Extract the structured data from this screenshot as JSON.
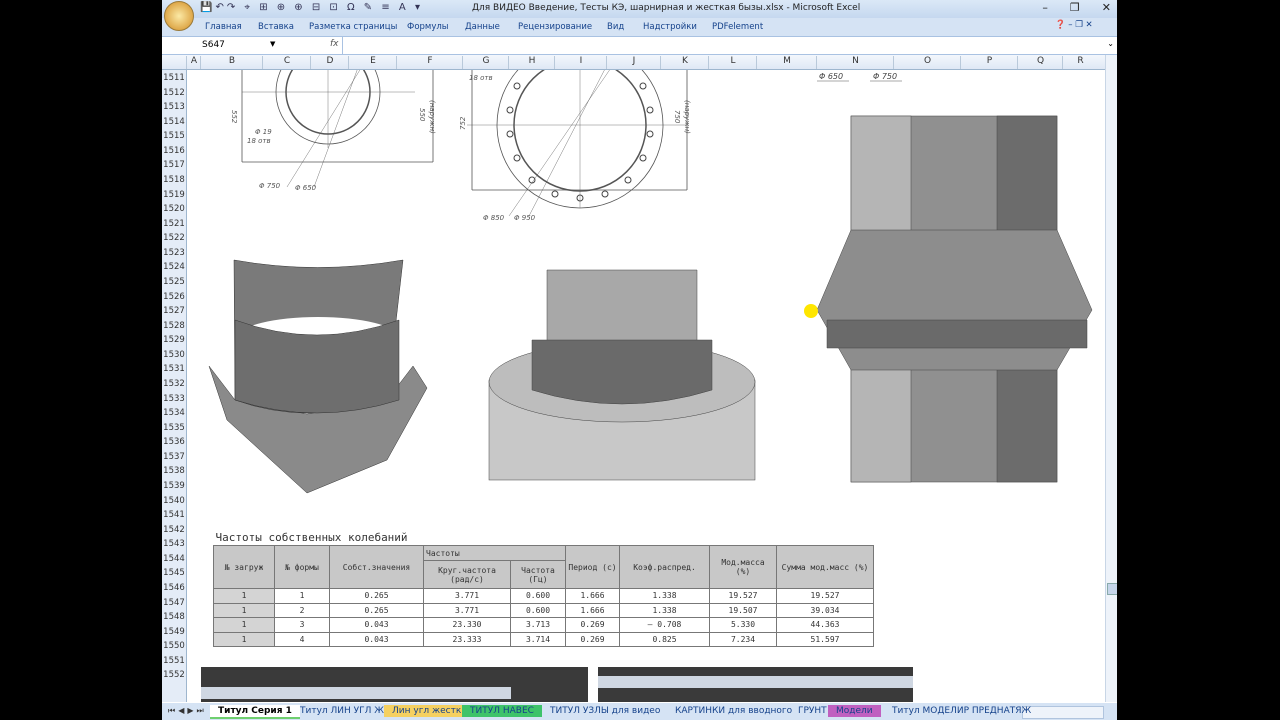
{
  "window": {
    "title": "Для ВИДЕО Введение, Тесты КЭ, шарнирная и жесткая бызы.xlsx - Microsoft Excel",
    "controls": [
      "–",
      "❐",
      "✕"
    ]
  },
  "ribbon": {
    "tabs": [
      "Главная",
      "Вставка",
      "Разметка страницы",
      "Формулы",
      "Данные",
      "Рецензирование",
      "Вид",
      "Надстройки",
      "PDFelement"
    ]
  },
  "formula_bar": {
    "name_box": "S647",
    "fx": "fx",
    "value": ""
  },
  "columns": [
    "A",
    "B",
    "C",
    "D",
    "E",
    "F",
    "G",
    "H",
    "I",
    "J",
    "K",
    "L",
    "M",
    "N",
    "O",
    "P",
    "Q",
    "R"
  ],
  "rows": [
    "1511",
    "1512",
    "1513",
    "1514",
    "1515",
    "1516",
    "1517",
    "1518",
    "1519",
    "1520",
    "1521",
    "1522",
    "1523",
    "1524",
    "1525",
    "1526",
    "1527",
    "1528",
    "1529",
    "1530",
    "1531",
    "1532",
    "1533",
    "1534",
    "1535",
    "1536",
    "1537",
    "1538",
    "1539",
    "1540",
    "1541",
    "1542",
    "1543",
    "1544",
    "1545",
    "1546",
    "1547",
    "1548",
    "1549",
    "1550",
    "1551",
    "1552"
  ],
  "drawings": {
    "d1": {
      "dims": [
        "552",
        "550",
        "(наружн)",
        "Φ 19",
        "18 отв",
        "Φ 750",
        "Φ 650"
      ]
    },
    "d2": {
      "dims": [
        "18 отв",
        "752",
        "750",
        "(наружн)",
        "Φ 850",
        "Φ 950"
      ]
    },
    "d3": {
      "dims": [
        "Φ 650",
        "Φ 750"
      ]
    }
  },
  "table": {
    "title": "Частоты собственных колебаний",
    "group_header": "Частоты",
    "headers": [
      "№ загруж",
      "№ формы",
      "Собст.значения",
      "Круг.частота (рад/с)",
      "Частота (Гц)",
      "Период (с)",
      "Коэф.распред.",
      "Мод.масса (%)",
      "Сумма мод.масс (%)"
    ],
    "rows": [
      [
        "1",
        "1",
        "0.265",
        "3.771",
        "0.600",
        "1.666",
        "1.338",
        "19.527",
        "19.527"
      ],
      [
        "1",
        "2",
        "0.265",
        "3.771",
        "0.600",
        "1.666",
        "1.338",
        "19.507",
        "39.034"
      ],
      [
        "1",
        "3",
        "0.043",
        "23.330",
        "3.713",
        "0.269",
        "– 0.708",
        "5.330",
        "44.363"
      ],
      [
        "1",
        "4",
        "0.043",
        "23.333",
        "3.714",
        "0.269",
        "0.825",
        "7.234",
        "51.597"
      ]
    ]
  },
  "sheet_tabs": [
    {
      "label": "Титул Серия 1",
      "color": "#6fcf6f",
      "active": true
    },
    {
      "label": "Титул ЛИН УГЛ Ж",
      "color": ""
    },
    {
      "label": "Лин угл жестк",
      "color": "#f5d060"
    },
    {
      "label": "ТИТУЛ НАВЕС",
      "color": "#3ec36a"
    },
    {
      "label": "ТИТУЛ УЗЛЫ для видео",
      "color": ""
    },
    {
      "label": "КАРТИНКИ для вводного",
      "color": ""
    },
    {
      "label": "ГРУНТ",
      "color": ""
    },
    {
      "label": "Модели",
      "color": "#c060c0"
    },
    {
      "label": "Титул МОДЕЛИР ПРЕДНАТЯЖ",
      "color": ""
    }
  ]
}
